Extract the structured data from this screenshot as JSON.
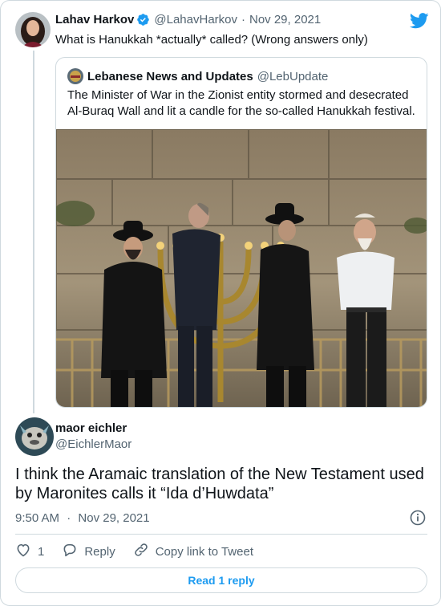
{
  "colors": {
    "accent": "#1d9bf0",
    "text": "#0f1419",
    "muted": "#536471",
    "border": "#cfd9de"
  },
  "parent": {
    "author_name": "Lahav Harkov",
    "verified_icon": "verified-badge-icon",
    "handle": "@LahavHarkov",
    "separator": "·",
    "date": "Nov 29, 2021",
    "text": "What is Hanukkah *actually* called? (Wrong answers only)"
  },
  "quoted": {
    "author_name": "Lebanese News and Updates",
    "handle": "@LebUpdate",
    "text": "The Minister of War in the Zionist entity stormed and desecrated Al-Buraq Wall and lit a candle for the so-called Hanukkah festival."
  },
  "reply": {
    "author_name": "maor eichler",
    "handle": "@EichlerMaor",
    "text": "I think the Aramaic translation of the New Testament used by Maronites calls it “Ida d’Huwdata”",
    "time": "9:50 AM",
    "separator": "·",
    "date": "Nov 29, 2021"
  },
  "actions": {
    "like_count": "1",
    "reply_label": "Reply",
    "copy_link_label": "Copy link to Tweet",
    "read_replies_label": "Read 1 reply"
  },
  "icons": {
    "brand": "twitter-bird-icon",
    "like": "heart-icon",
    "reply": "speech-bubble-icon",
    "copy_link": "link-icon",
    "info": "info-icon"
  }
}
